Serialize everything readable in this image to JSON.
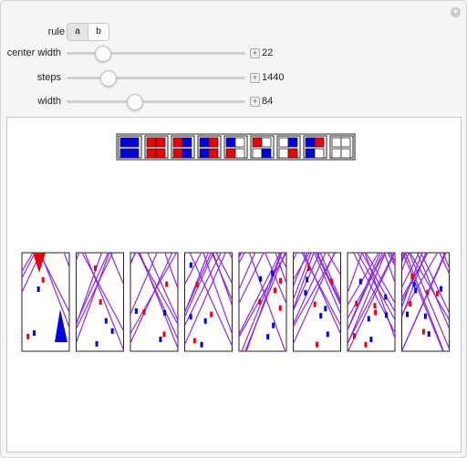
{
  "controls": {
    "rule": {
      "label": "rule",
      "options": [
        "a",
        "b"
      ],
      "selected": "b"
    },
    "center_width": {
      "label": "center width",
      "value": "22",
      "fraction": 0.2
    },
    "steps": {
      "label": "steps",
      "value": "1440",
      "fraction": 0.23
    },
    "width": {
      "label": "width",
      "value": "84",
      "fraction": 0.38
    }
  },
  "colors": {
    "red": "#f00000",
    "blue": "#0000e6",
    "line_purple": "#8a2be2",
    "frame": "#222222"
  },
  "rule_icons": [
    [
      "BB",
      "BB"
    ],
    [
      "RR",
      "RR"
    ],
    [
      "RB",
      "RB"
    ],
    [
      "BR",
      "BR"
    ],
    [
      "BW",
      "RW"
    ],
    [
      "RW",
      "WB"
    ],
    [
      "WB",
      "WR"
    ],
    [
      "BR",
      "BW"
    ],
    [
      "WW",
      "WW"
    ]
  ],
  "evolution_count": 8
}
